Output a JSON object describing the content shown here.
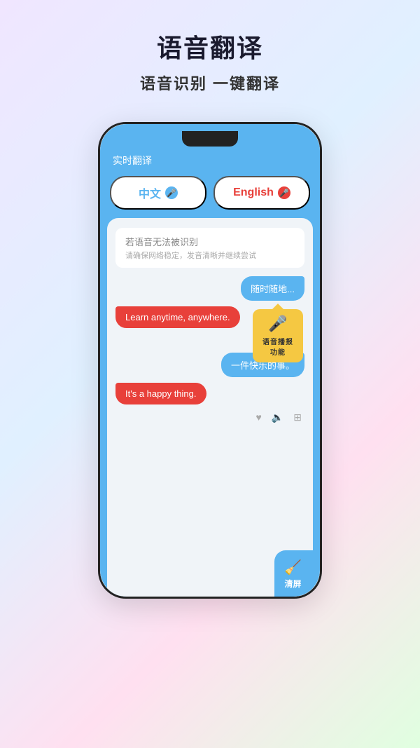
{
  "header": {
    "title": "语音翻译",
    "subtitle": "语音识别 一键翻译"
  },
  "phone": {
    "screen_header": "实时翻译",
    "lang_left": {
      "label": "中文",
      "mic_color": "blue"
    },
    "lang_right": {
      "label": "English",
      "mic_color": "red"
    },
    "error_box": {
      "title": "若语音无法被识别",
      "subtitle": "请确保网络稳定，发音清晰并继续尝试"
    },
    "messages": [
      {
        "side": "right",
        "text": "随时随地...",
        "bubble_color": "blue"
      },
      {
        "side": "left",
        "text": "Learn anytime, anywhere.",
        "bubble_color": "red"
      },
      {
        "side": "right",
        "text": "一件快乐的事。",
        "bubble_color": "blue"
      },
      {
        "side": "left",
        "text": "It's a happy thing.",
        "bubble_color": "red"
      }
    ],
    "tooltip": {
      "icon": "🎤",
      "label": "语音播报功能"
    },
    "clear_button": {
      "icon": "🧹",
      "label": "清屏"
    }
  }
}
